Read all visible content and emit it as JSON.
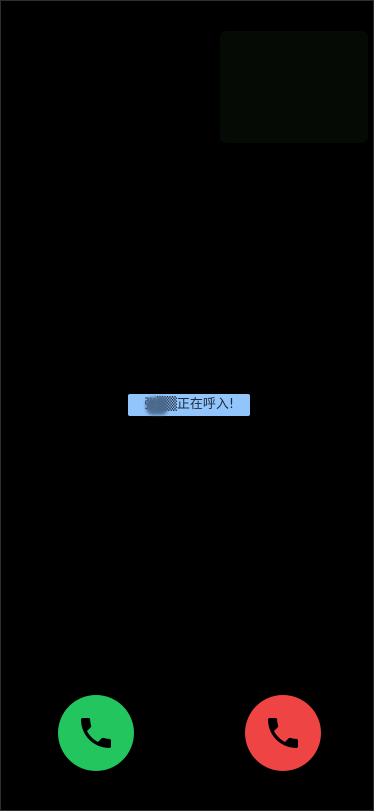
{
  "call": {
    "caller_text": "张▒▒正在呼入!"
  },
  "buttons": {
    "accept": {
      "icon": "phone-icon",
      "color": "#22c55e"
    },
    "decline": {
      "icon": "phone-icon",
      "color": "#ef4444"
    }
  },
  "colors": {
    "background": "#000000",
    "caller_badge": "#93c5fd"
  }
}
